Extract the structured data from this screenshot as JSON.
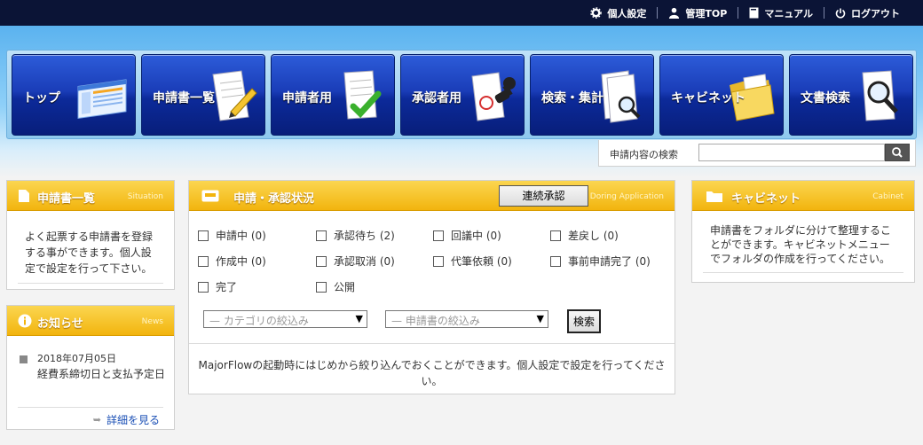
{
  "topnav": {
    "personal": "個人設定",
    "admin": "管理TOP",
    "manual": "マニュアル",
    "logout": "ログアウト"
  },
  "mainnav": [
    {
      "label": "トップ",
      "icon": "dashboard-icon"
    },
    {
      "label": "申請書一覧",
      "icon": "document-pencil-icon"
    },
    {
      "label": "申請者用",
      "icon": "document-check-icon"
    },
    {
      "label": "承認者用",
      "icon": "stamp-icon"
    },
    {
      "label": "検索・集計",
      "icon": "search-document-icon"
    },
    {
      "label": "キャビネット",
      "icon": "folder-icon"
    },
    {
      "label": "文書検索",
      "icon": "document-magnifier-icon"
    }
  ],
  "search": {
    "label": "申請内容の検索",
    "placeholder": ""
  },
  "left_panel": {
    "title": "申請書一覧",
    "subtitle": "Situation",
    "text": "よく起票する申請書を登録する事ができます。個人設定で設定を行って下さい。"
  },
  "news_panel": {
    "title": "お知らせ",
    "subtitle": "News",
    "date": "2018年07月05日",
    "item": "経費系締切日と支払予定日",
    "more": "詳細を見る"
  },
  "status_panel": {
    "title": "申請・承認状況",
    "subtitle": "Doring Application",
    "bulk_button": "連続承認",
    "checks": [
      "申請中 (0)",
      "承認待ち (2)",
      "回議中 (0)",
      "差戻し (0)",
      "作成中 (0)",
      "承認取消 (0)",
      "代筆依頼 (0)",
      "事前申請完了 (0)",
      "完了",
      "公開"
    ],
    "category_select": "— カテゴリの絞込み",
    "form_select": "— 申請書の絞込み",
    "search_button": "検索",
    "note": "MajorFlowの起動時にはじめから絞り込んでおくことができます。個人設定で設定を行ってください。"
  },
  "cabinet_panel": {
    "title": "キャビネット",
    "subtitle": "Cabinet",
    "text": "申請書をフォルダに分けて整理することができます。キャビネットメニューでフォルダの作成を行ってください。"
  }
}
